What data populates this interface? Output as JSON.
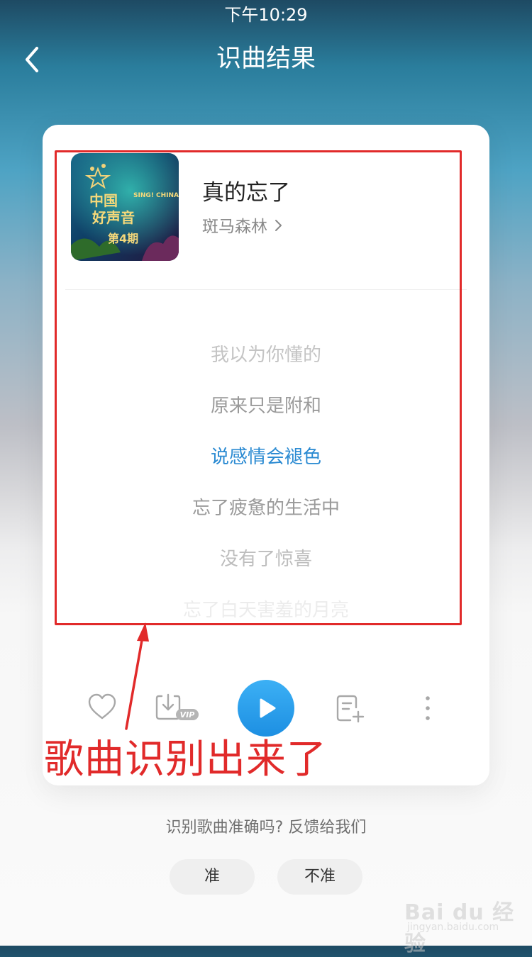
{
  "status_bar": {
    "time": "下午10:29"
  },
  "nav": {
    "title": "识曲结果"
  },
  "song": {
    "title": "真的忘了",
    "artist": "斑马森林",
    "cover_text": {
      "line1": "中国",
      "line2": "好声音",
      "badge": "SING! CHINA",
      "episode": "第4期"
    }
  },
  "lyrics": [
    "我以为你懂的",
    "原来只是附和",
    "说感情会褪色",
    "忘了疲惫的生活中",
    "没有了惊喜",
    "忘了白天害羞的月亮"
  ],
  "controls": {
    "heart": "heart-icon",
    "download": "download-vip-icon",
    "download_badge": "VIP",
    "play": "play-icon",
    "playlist": "add-to-playlist-icon",
    "more": "more-vertical-icon"
  },
  "annotation": {
    "text": "歌曲识别出来了",
    "color": "#e12a2a"
  },
  "feedback": {
    "question": "识别歌曲准确吗? 反馈给我们",
    "yes": "准",
    "no": "不准"
  },
  "watermark": {
    "brand": "Bai du 经验",
    "site": "jingyan.baidu.com"
  },
  "colors": {
    "accent": "#2a8ad2",
    "annotation_red": "#e12a2a",
    "play_button": "#2aa0ee"
  }
}
